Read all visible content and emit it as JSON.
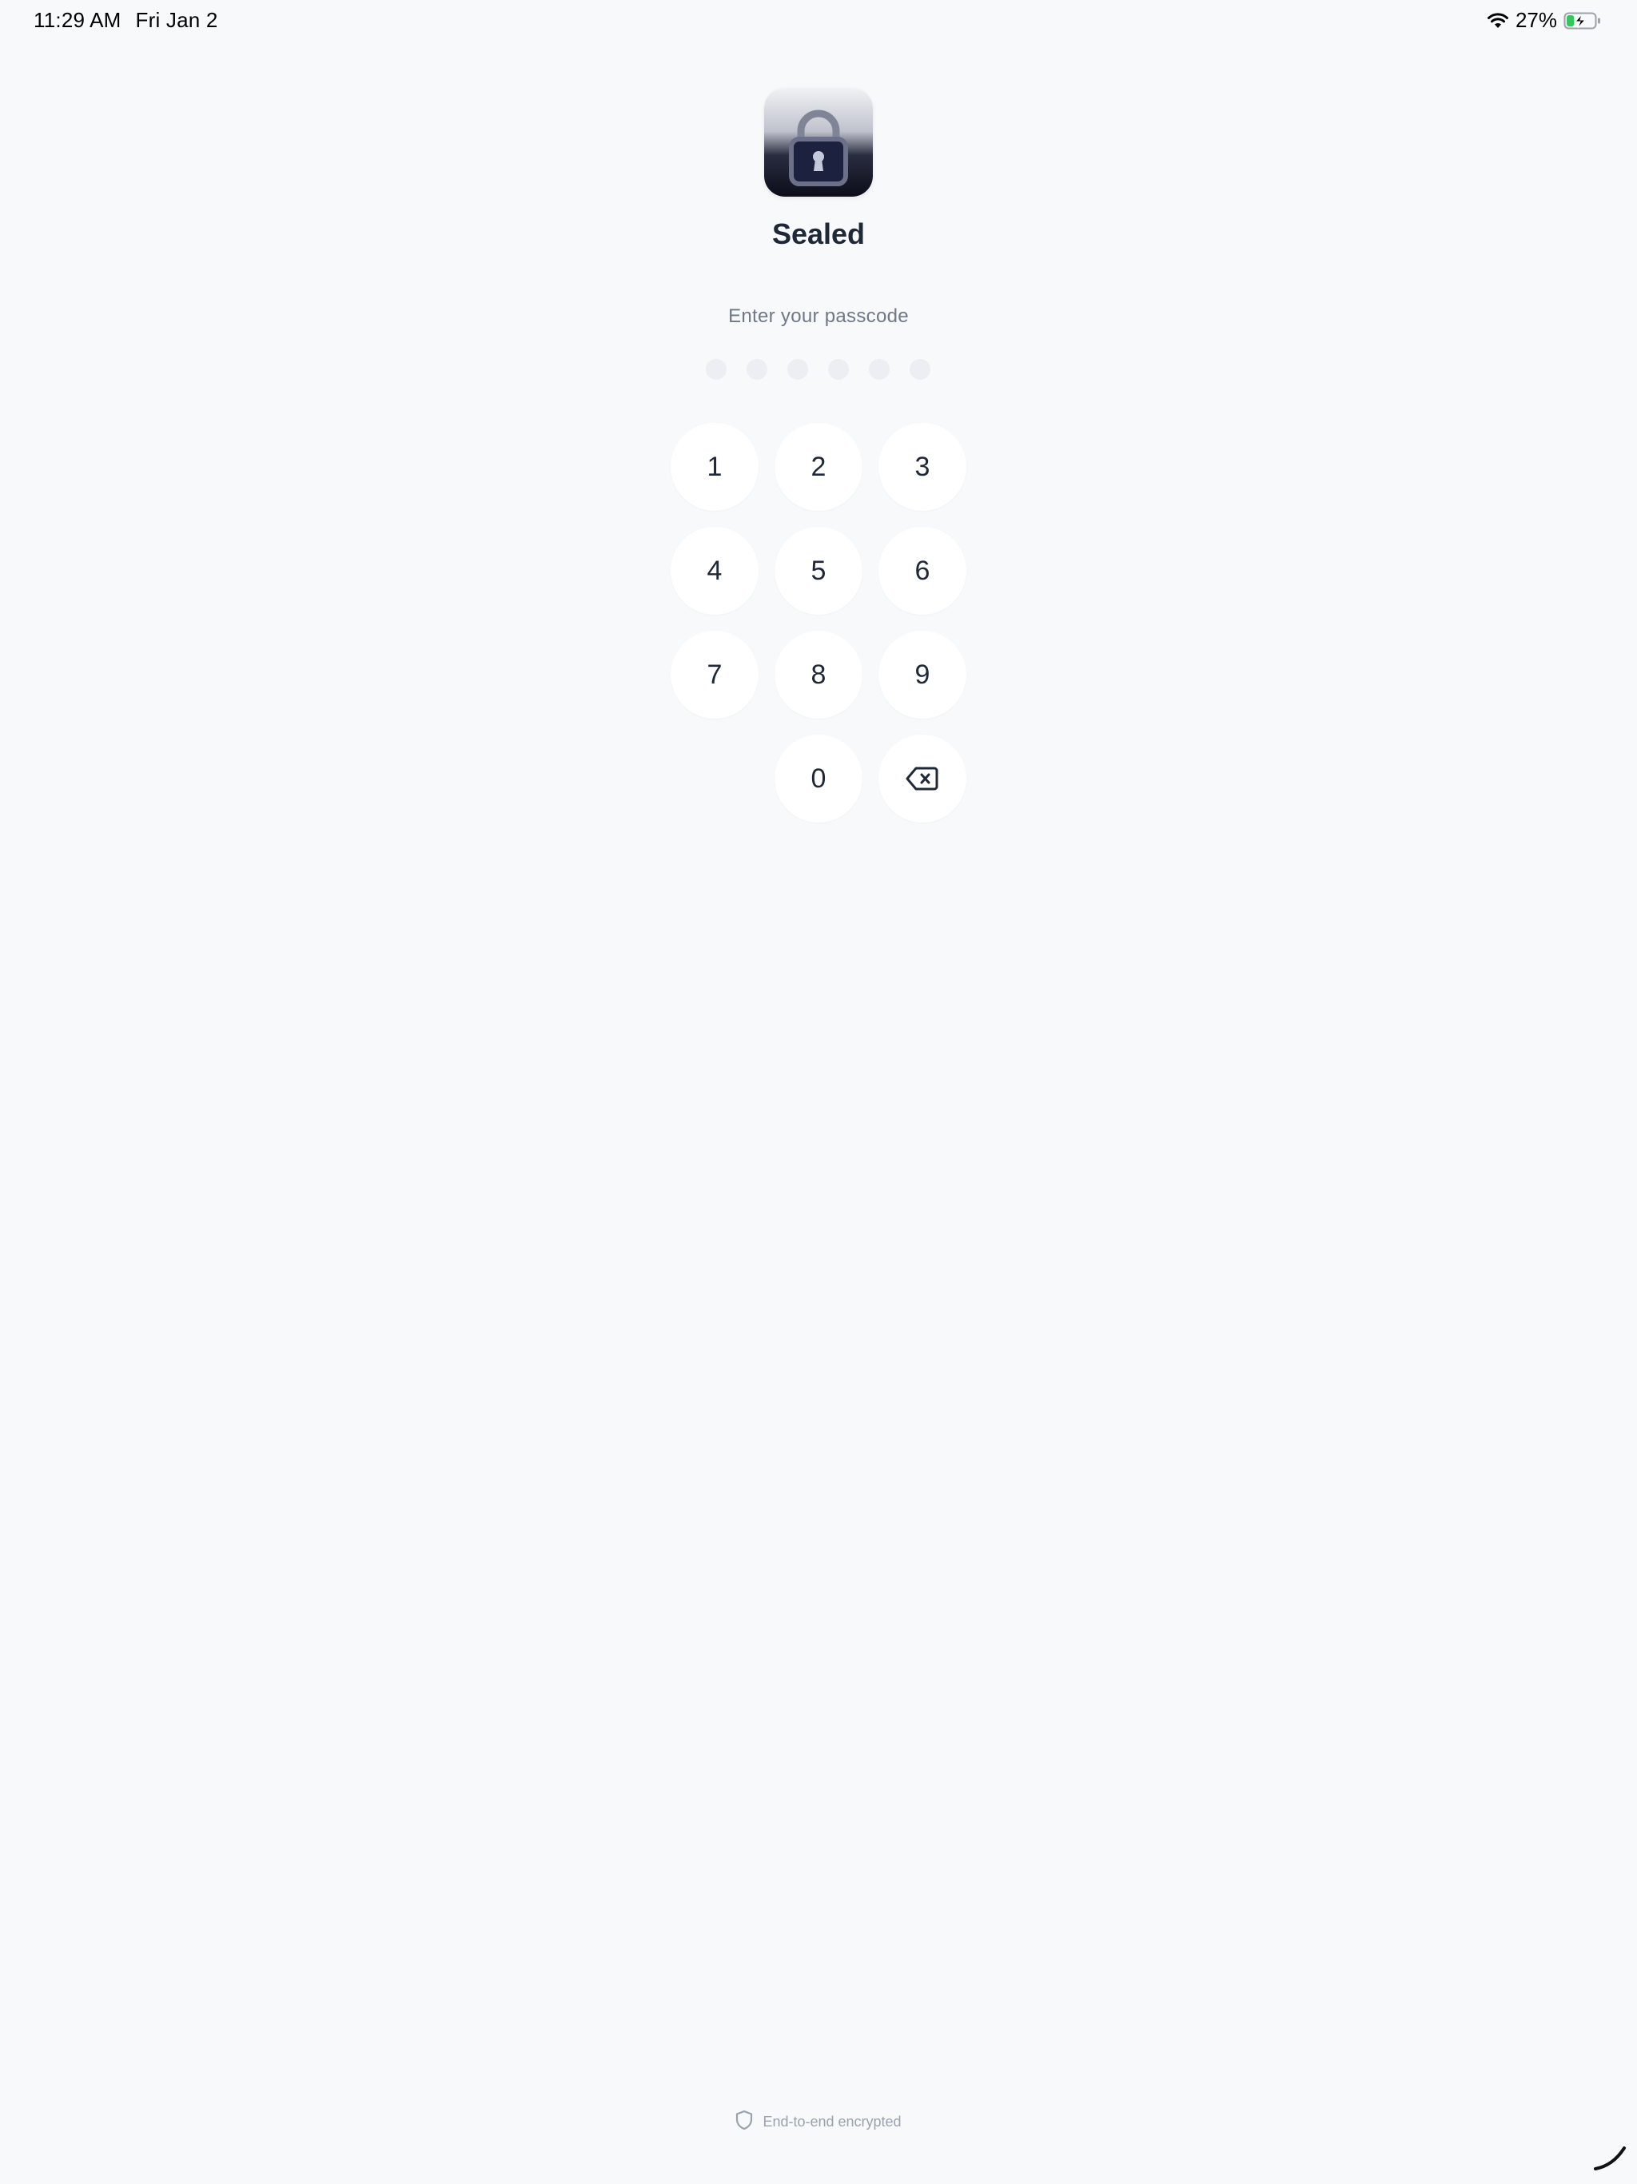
{
  "status_bar": {
    "time": "11:29 AM",
    "date": "Fri Jan 2",
    "battery_percent": "27%",
    "battery_level": 0.27,
    "charging": true,
    "battery_color": "#34c759"
  },
  "app": {
    "icon": "lock-icon",
    "title": "Sealed"
  },
  "passcode": {
    "prompt": "Enter your passcode",
    "length": 6,
    "entered": 0
  },
  "keypad": {
    "keys": [
      "1",
      "2",
      "3",
      "4",
      "5",
      "6",
      "7",
      "8",
      "9",
      "0"
    ],
    "delete_icon": "backspace-icon"
  },
  "footer": {
    "icon": "shield-icon",
    "text": "End-to-end encrypted"
  },
  "colors": {
    "background": "#f7f9fb",
    "text_primary": "#1e2836",
    "text_secondary": "#6e7888",
    "dot_empty": "#eceef3"
  }
}
